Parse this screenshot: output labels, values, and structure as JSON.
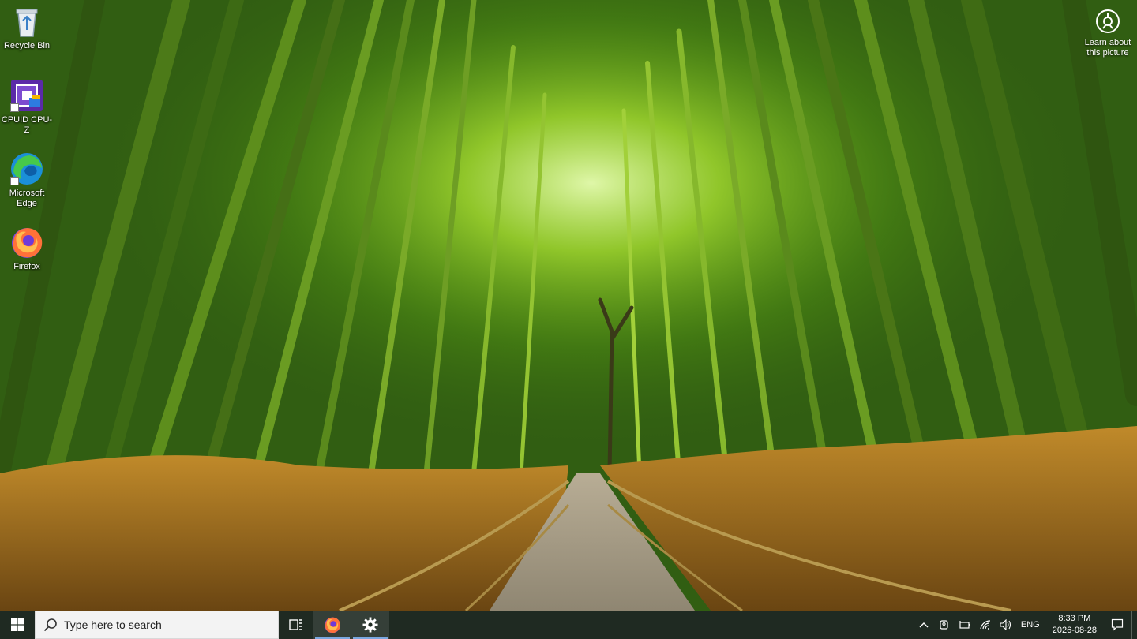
{
  "desktop": {
    "icons": [
      {
        "label": "Recycle Bin",
        "icon": "recycle-bin-icon"
      },
      {
        "label": "CPUID CPU-Z",
        "icon": "cpuz-icon"
      },
      {
        "label": "Microsoft Edge",
        "icon": "edge-icon"
      },
      {
        "label": "Firefox",
        "icon": "firefox-icon"
      }
    ],
    "learn_about": {
      "label": "Learn about this picture",
      "icon": "camera-circle-icon"
    }
  },
  "taskbar": {
    "search_placeholder": "Type here to search",
    "pinned": [
      {
        "name": "task-view",
        "icon": "task-view-icon"
      },
      {
        "name": "firefox",
        "icon": "firefox-icon"
      },
      {
        "name": "settings",
        "icon": "gear-icon"
      }
    ],
    "tray": {
      "language": "ENG",
      "time": "8:33 PM",
      "date": "2026-08-28"
    }
  },
  "colors": {
    "taskbar_bg": "#1f2a22",
    "search_bg": "#f3f3f3",
    "active_indicator": "#7aa7e0"
  }
}
